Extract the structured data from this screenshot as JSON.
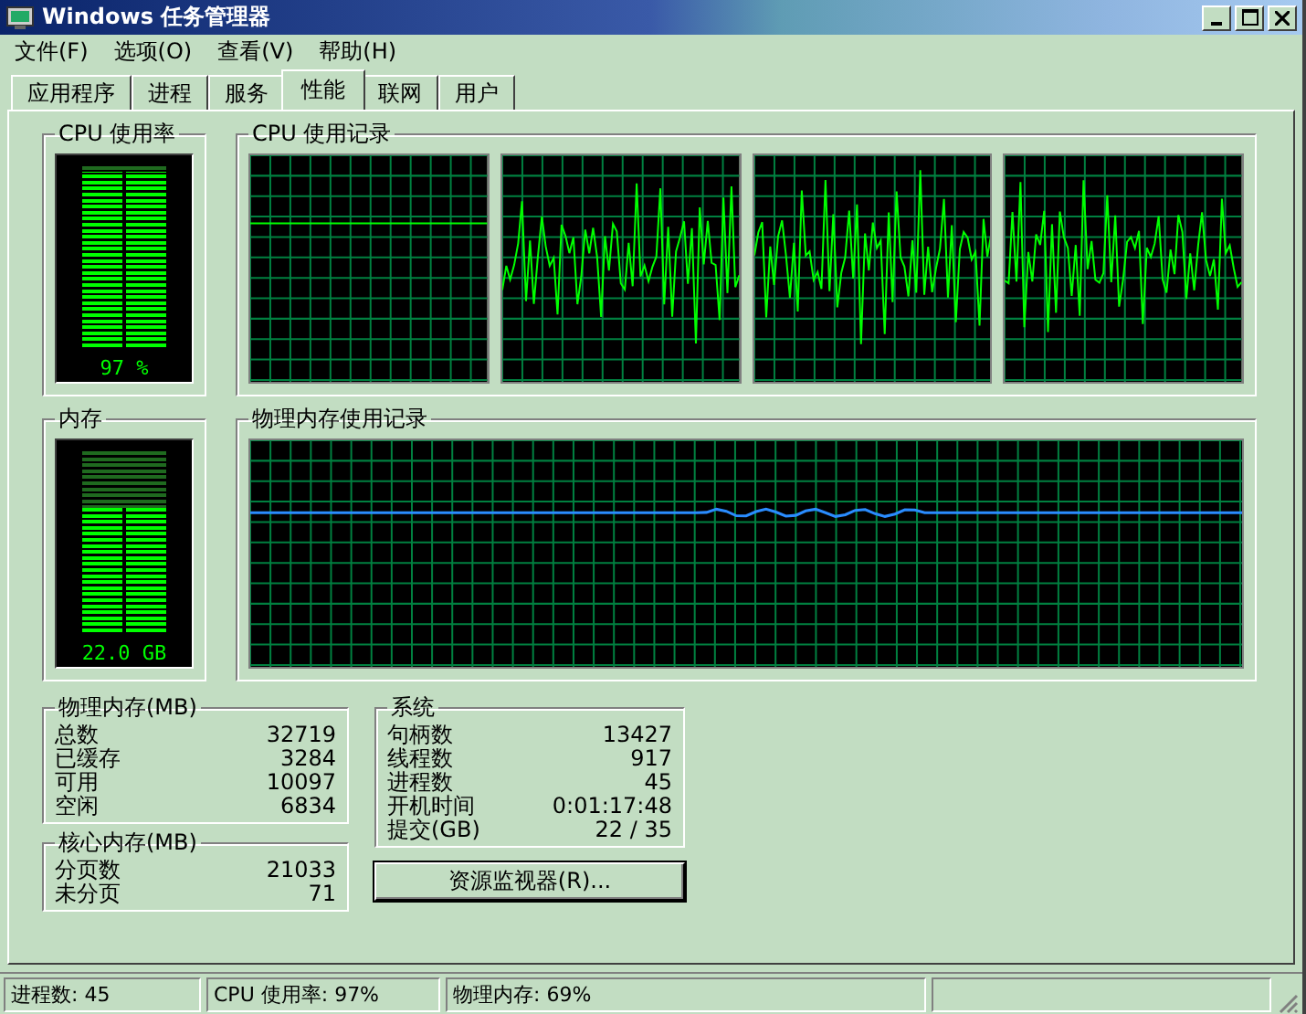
{
  "window": {
    "title": "Windows 任务管理器"
  },
  "menu": [
    "文件(F)",
    "选项(O)",
    "查看(V)",
    "帮助(H)"
  ],
  "tabs": [
    {
      "label": "应用程序",
      "selected": false
    },
    {
      "label": "进程",
      "selected": false
    },
    {
      "label": "服务",
      "selected": false
    },
    {
      "label": "性能",
      "selected": true
    },
    {
      "label": "联网",
      "selected": false
    },
    {
      "label": "用户",
      "selected": false
    }
  ],
  "cpu_meter": {
    "title": "CPU 使用率",
    "level": 0.97,
    "reading": "97 %"
  },
  "cpu_history": {
    "title": "CPU 使用记录"
  },
  "memory_meter": {
    "title": "内存",
    "level": 0.69,
    "reading": "22.0 GB"
  },
  "memory_history": {
    "title": "物理内存使用记录"
  },
  "physical_memory": {
    "title": "物理内存(MB)",
    "rows": [
      {
        "label": "总数",
        "value": "32719"
      },
      {
        "label": "已缓存",
        "value": "3284"
      },
      {
        "label": "可用",
        "value": "10097"
      },
      {
        "label": "空闲",
        "value": "6834"
      }
    ]
  },
  "kernel_memory": {
    "title": "核心内存(MB)",
    "rows": [
      {
        "label": "分页数",
        "value": "21033"
      },
      {
        "label": "未分页",
        "value": "71"
      }
    ]
  },
  "system": {
    "title": "系统",
    "rows": [
      {
        "label": "句柄数",
        "value": "13427"
      },
      {
        "label": "线程数",
        "value": "917"
      },
      {
        "label": "进程数",
        "value": "45"
      },
      {
        "label": "开机时间",
        "value": "0:01:17:48"
      },
      {
        "label": "提交(GB)",
        "value": "22 / 35"
      }
    ]
  },
  "resource_monitor_button": "资源监视器(R)...",
  "status_bar": [
    "进程数: 45",
    "CPU 使用率: 97%",
    "物理内存: 69%"
  ]
}
